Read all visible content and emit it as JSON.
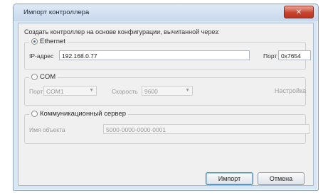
{
  "window": {
    "title": "Импорт контроллера",
    "close_glyph": "✕"
  },
  "prompt": "Создать контроллер на основе конфигурации, вычитанной через:",
  "ethernet": {
    "label": "Ethernet",
    "selected": true,
    "ip_label": "IP-адрес",
    "ip_value": "192.168.0.77",
    "port_label": "Порт",
    "port_value": "0x7654"
  },
  "com": {
    "label": "COM",
    "selected": false,
    "port_label": "Порт",
    "port_value": "COM1",
    "speed_label": "Скорость",
    "speed_value": "9600",
    "settings_label": "Настройка"
  },
  "comm_server": {
    "label": "Коммуникационный сервер",
    "selected": false,
    "object_label": "Имя объекта",
    "object_value": "5000-0000-0000-0001"
  },
  "buttons": {
    "import": "Импорт",
    "cancel": "Отмена"
  },
  "icons": {
    "close": "close-icon",
    "dropdown": "chevron-down-icon"
  },
  "colors": {
    "title_bar": "#c8d9ec",
    "close_button": "#c9452f",
    "accent": "#2f6fbf"
  }
}
